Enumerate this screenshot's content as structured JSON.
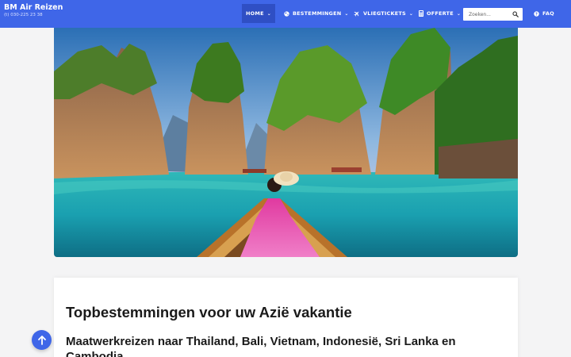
{
  "brand": {
    "name": "BM Air Reizen",
    "phone": "(t) 030-225 23 38"
  },
  "nav": {
    "home": "HOME",
    "bestemmingen": "BESTEMMINGEN",
    "vliegtickets": "VLIEGTICKETS",
    "offerte": "OFFERTE",
    "faq": "FAQ"
  },
  "search": {
    "placeholder": "Zoeken..."
  },
  "content": {
    "heading": "Topbestemmingen voor uw Azië vakantie",
    "subheading": "Maatwerkreizen naar Thailand, Bali, Vietnam, Indonesië, Sri Lanka en Cambodja"
  },
  "colors": {
    "header": "#3f66e8",
    "active_nav": "#2f4fc4",
    "scroll_button": "#3f66e8"
  },
  "icons": {
    "bestemmingen": "globe-icon",
    "vliegtickets": "plane-icon",
    "offerte": "calculator-icon",
    "faq": "question-circle-icon",
    "search": "search-icon",
    "scroll": "arrow-up-icon"
  }
}
